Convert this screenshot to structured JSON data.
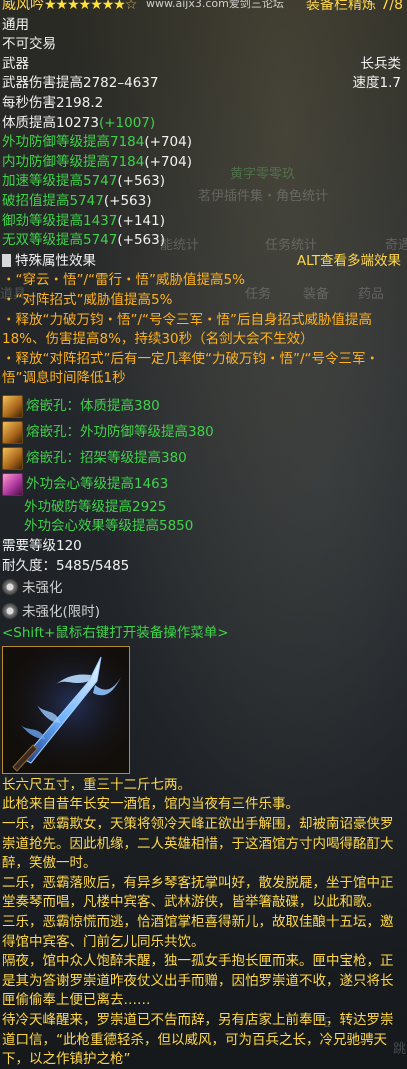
{
  "title": {
    "name": "威风吟",
    "stars_filled": 7,
    "stars_total": 8,
    "watermark": "www.aijx3.com爱剑三论坛",
    "slot_label": "装备栏精炼 7/8"
  },
  "binding": "通用",
  "trade": "不可交易",
  "category": "武器",
  "weapon_type": "长兵类",
  "damage": "武器伤害提高2782–4637",
  "speed": "速度1.7",
  "dps": "每秒伤害2198.2",
  "stats": [
    {
      "base": "体质提高10273",
      "bonus": "(+1007)",
      "color": "white"
    },
    {
      "base": "外功防御等级提高7184",
      "bonus": "(+704)",
      "color": "green"
    },
    {
      "base": "内功防御等级提高7184",
      "bonus": "(+704)",
      "color": "green"
    },
    {
      "base": "加速等级提高5747",
      "bonus": "(+563)",
      "color": "green"
    },
    {
      "base": "破招值提高5747",
      "bonus": "(+563)",
      "color": "green"
    },
    {
      "base": "御劲等级提高1437",
      "bonus": "(+141)",
      "color": "green"
    },
    {
      "base": "无双等级提高5747",
      "bonus": "(+563)",
      "color": "green"
    }
  ],
  "special": {
    "header": "特殊属性效果",
    "alt_hint": "ALT查看多端效果",
    "lines": [
      "・“穿云・悟”/“雷行・悟”威胁值提高5%",
      "・“对阵招式”威胁值提高5%",
      "・释放“力破万钧・悟”/“号令三军・悟”后自身招式威胁值提高18%、伤害提高8%，持续30秒（名剑大会不生效）",
      "・释放“对阵招式”后有一定几率使“力破万钧・悟”/“号令三军・悟”调息时间降低1秒"
    ]
  },
  "sockets": [
    {
      "text": "熔嵌孔：体质提高380",
      "gem": "tan"
    },
    {
      "text": "熔嵌孔：外功防御等级提高380",
      "gem": "tan"
    },
    {
      "text": "熔嵌孔：招架等级提高380",
      "gem": "tan"
    }
  ],
  "set_gem": {
    "lines": [
      "外功会心等级提高1463",
      "外功破防等级提高2925",
      "外功会心效果等级提高5850"
    ]
  },
  "required_level": "需要等级120",
  "durability": "耐久度：5485/5485",
  "enhance": "未强化",
  "enhance_limited": "未强化(限时)",
  "shift_hint": "<Shift+鼠标右键打开装备操作菜单>",
  "story": [
    "长六尺五寸，重三十二斤七两。",
    "此枪来自昔年长安一酒馆，馆内当夜有三件乐事。",
    "一乐，恶霸欺女，天策将领冷天峰正欲出手解围，却被南诏豪侠罗崇道抢先。因此机缘，二人英雄相惜，于这酒馆方寸内喝得酩酊大醉，笑傲一时。",
    "二乐，恶霸落败后，有异乡琴客抚掌叫好，散发脱屣，坐于馆中正堂奏琴而唱，凡楼中宾客、武林游侠，皆举箸敲碟，以此和歌。",
    "三乐，恶霸惊慌而逃，恰酒馆掌柜喜得新儿，故取佳酿十五坛，邀得馆中宾客、门前乞儿同乐共饮。",
    "隔夜，馆中众人饱醉未醒，独一孤女手抱长匣而来。匣中宝枪，正是其为答谢罗崇道昨夜仗义出手而赠，因怕罗崇道不收，遂只将长匣偷偷奉上便已离去……",
    "待冷天峰醒来，罗崇道已不告而辞，另有店家上前奉匣，转达罗崇道口信，“此枪重德轻杀，但以威风，可为百兵之长，冷兄驰骋天下，以之作镇护之枪”"
  ],
  "background": {
    "panel1": "黄字零零玖",
    "panel2": "茗伊插件集・角色统计",
    "tabs": [
      "能统计",
      "任务统计",
      "奇遇"
    ],
    "menu": [
      "道具",
      "任务",
      "装备",
      "药品"
    ],
    "farm": "E",
    "farm2": "跳"
  },
  "colors": {
    "stat_green": "#3fd24a",
    "special_orange": "#ffb21e",
    "title_gold": "#ffd84a",
    "frame_gold": "#b8892f"
  },
  "icons": [
    "star-icon",
    "socket-icon",
    "gem-icon",
    "enhance-slot-icon",
    "weapon-spear-image"
  ]
}
